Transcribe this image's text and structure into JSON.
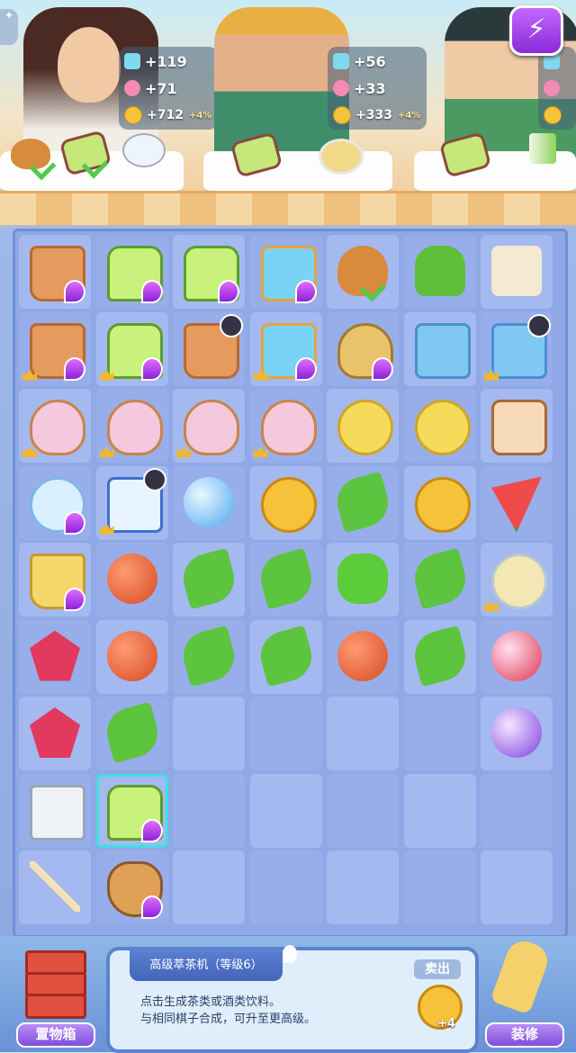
{
  "customers": [
    {
      "name": "customer-woman",
      "rewards": {
        "vials": "+119",
        "flowers": "+71",
        "coins": "+712",
        "bonus": "+4%"
      },
      "orders": [
        "roast-chicken",
        "sandwich",
        "teapot"
      ]
    },
    {
      "name": "customer-cook",
      "rewards": {
        "vials": "+56",
        "flowers": "+33",
        "coins": "+333",
        "bonus": "+4%"
      },
      "orders": [
        "sandwich",
        "tea-cup"
      ]
    },
    {
      "name": "customer-boy",
      "rewards": {
        "vials": "",
        "flowers": "",
        "coins": "",
        "bonus": ""
      },
      "orders": [
        "sandwich",
        "scallions"
      ]
    }
  ],
  "power_button_icon": "lightning-icon",
  "board": {
    "columns": 7,
    "rows": 9,
    "cells": [
      [
        {
          "i": "basket",
          "lv": 1
        },
        {
          "i": "blender",
          "lv": 1
        },
        {
          "i": "blender",
          "lv": 1
        },
        {
          "i": "aquarium",
          "lv": 1
        },
        {
          "i": "chicken",
          "check": 1
        },
        {
          "i": "broccoli"
        },
        {
          "i": "paper"
        }
      ],
      [
        {
          "i": "basket",
          "lv": 1,
          "crown": 1
        },
        {
          "i": "blender",
          "lv": 1,
          "crown": 1
        },
        {
          "i": "basket",
          "timer": 1
        },
        {
          "i": "aquarium",
          "lv": 1,
          "crown": 1
        },
        {
          "i": "pot",
          "lv": 1
        },
        {
          "i": "fridge"
        },
        {
          "i": "fridge",
          "timer": 1,
          "crown": 1
        }
      ],
      [
        {
          "i": "icecream",
          "crown": 1
        },
        {
          "i": "icecream",
          "crown": 1
        },
        {
          "i": "icecream",
          "crown": 1
        },
        {
          "i": "icecream",
          "crown": 1
        },
        {
          "i": "cake"
        },
        {
          "i": "cake"
        },
        {
          "i": "pastry"
        }
      ],
      [
        {
          "i": "bowl",
          "lv": 1
        },
        {
          "i": "chest",
          "timer": 1,
          "crown": 1
        },
        {
          "i": "orb"
        },
        {
          "i": "coins"
        },
        {
          "i": "pepper"
        },
        {
          "i": "coins"
        },
        {
          "i": "watermelon"
        }
      ],
      [
        {
          "i": "bucket",
          "lv": 1
        },
        {
          "i": "apple"
        },
        {
          "i": "pepper"
        },
        {
          "i": "pepper"
        },
        {
          "i": "bellpep"
        },
        {
          "i": "pepper"
        },
        {
          "i": "soup",
          "crown": 1
        }
      ],
      [
        {
          "i": "gem"
        },
        {
          "i": "apple"
        },
        {
          "i": "pepper"
        },
        {
          "i": "pepper"
        },
        {
          "i": "apple"
        },
        {
          "i": "pepper"
        },
        {
          "i": "orb-red"
        }
      ],
      [
        {
          "i": "gem"
        },
        {
          "i": "pepper"
        },
        {},
        {},
        {},
        {},
        {
          "i": "orb-purple"
        }
      ],
      [
        {
          "i": "tray"
        },
        {
          "i": "blender",
          "lv": 1,
          "selected": 1
        },
        {},
        {},
        {},
        {},
        {}
      ],
      [
        {
          "i": "swabs"
        },
        {
          "i": "greens",
          "lv": 1
        },
        {},
        {},
        {},
        {},
        {}
      ]
    ]
  },
  "bottom": {
    "storage_label": "置物箱",
    "decor_label": "装修",
    "info_title": "高级萃茶机（等级6）",
    "info_desc_line1": "点击生成茶类或酒类饮料。",
    "info_desc_line2": "与相同棋子合成，可升至更高级。",
    "sell_label": "卖出",
    "sell_value": "+4"
  },
  "colors": {
    "board": "#8fa9e6",
    "accent": "#8a2bd9",
    "selection": "#40e0e0"
  }
}
